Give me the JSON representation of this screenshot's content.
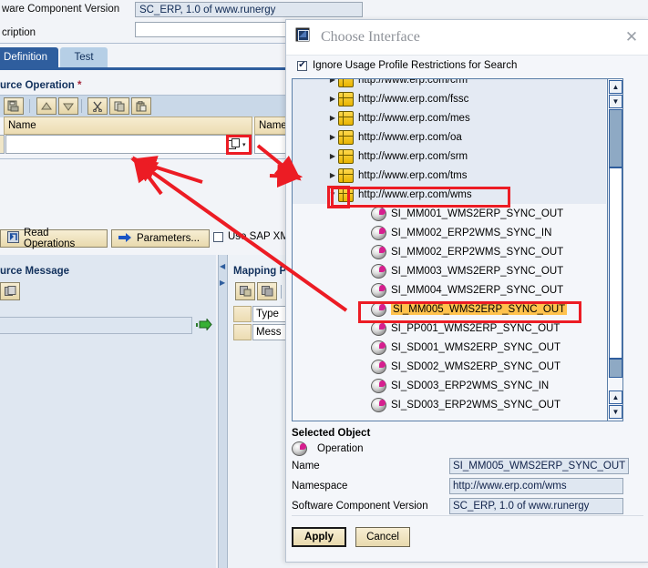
{
  "background": {
    "fields": [
      {
        "label": "ware Component Version",
        "value": "SC_ERP, 1.0 of www.runergy"
      },
      {
        "label": "cription",
        "value": ""
      }
    ],
    "tabs": [
      {
        "label": "Definition",
        "selected": true
      },
      {
        "label": "Test",
        "selected": false
      }
    ],
    "source_operation_title": "urce Operation",
    "required_marker": "*",
    "grid_header_left": "Name",
    "grid_header_right": "Name",
    "buttons": [
      {
        "label": "Read Operations",
        "icon": "read-operations-icon"
      },
      {
        "label": "Parameters...",
        "icon": "arrow-right-icon"
      }
    ],
    "checkbox_label": "Use SAP XM",
    "source_message_title": "urce Message",
    "mapping_panel_title": "Mapping P",
    "mapping_rows": [
      "Type",
      "Mess"
    ]
  },
  "dialog": {
    "title": "Choose Interface",
    "title_icon": "window-icon",
    "close_icon": "close-icon",
    "ignore_checkbox": {
      "label": "Ignore Usage Profile Restrictions for Search",
      "checked": true,
      "mark": "✔"
    },
    "tree": [
      {
        "label": "http://www.erp.com/crm",
        "type": "namespace",
        "expanded": false,
        "twisty": "▶",
        "indent": 0,
        "clipped": true,
        "selected": false
      },
      {
        "label": "http://www.erp.com/fssc",
        "type": "namespace",
        "expanded": false,
        "twisty": "▶",
        "indent": 0,
        "clipped": false,
        "selected": false
      },
      {
        "label": "http://www.erp.com/mes",
        "type": "namespace",
        "expanded": false,
        "twisty": "▶",
        "indent": 0,
        "clipped": false,
        "selected": false
      },
      {
        "label": "http://www.erp.com/oa",
        "type": "namespace",
        "expanded": false,
        "twisty": "▶",
        "indent": 0,
        "clipped": false,
        "selected": false
      },
      {
        "label": "http://www.erp.com/srm",
        "type": "namespace",
        "expanded": false,
        "twisty": "▶",
        "indent": 0,
        "clipped": false,
        "selected": false
      },
      {
        "label": "http://www.erp.com/tms",
        "type": "namespace",
        "expanded": false,
        "twisty": "▶",
        "indent": 0,
        "clipped": false,
        "selected": false
      },
      {
        "label": "http://www.erp.com/wms",
        "type": "namespace",
        "expanded": true,
        "twisty": "▼",
        "indent": 0,
        "clipped": false,
        "selected": false
      },
      {
        "label": "SI_MM001_WMS2ERP_SYNC_OUT",
        "type": "operation",
        "twisty": "",
        "indent": 1,
        "clipped": false,
        "selected": false
      },
      {
        "label": "SI_MM002_ERP2WMS_SYNC_IN",
        "type": "operation",
        "twisty": "",
        "indent": 1,
        "clipped": false,
        "selected": false
      },
      {
        "label": "SI_MM002_ERP2WMS_SYNC_OUT",
        "type": "operation",
        "twisty": "",
        "indent": 1,
        "clipped": false,
        "selected": false
      },
      {
        "label": "SI_MM003_WMS2ERP_SYNC_OUT",
        "type": "operation",
        "twisty": "",
        "indent": 1,
        "clipped": false,
        "selected": false
      },
      {
        "label": "SI_MM004_WMS2ERP_SYNC_OUT",
        "type": "operation",
        "twisty": "",
        "indent": 1,
        "clipped": false,
        "selected": false
      },
      {
        "label": "SI_MM005_WMS2ERP_SYNC_OUT",
        "type": "operation",
        "twisty": "",
        "indent": 1,
        "clipped": false,
        "selected": true
      },
      {
        "label": "SI_PP001_WMS2ERP_SYNC_OUT",
        "type": "operation",
        "twisty": "",
        "indent": 1,
        "clipped": false,
        "selected": false
      },
      {
        "label": "SI_SD001_WMS2ERP_SYNC_OUT",
        "type": "operation",
        "twisty": "",
        "indent": 1,
        "clipped": false,
        "selected": false
      },
      {
        "label": "SI_SD002_WMS2ERP_SYNC_OUT",
        "type": "operation",
        "twisty": "",
        "indent": 1,
        "clipped": false,
        "selected": false
      },
      {
        "label": "SI_SD003_ERP2WMS_SYNC_IN",
        "type": "operation",
        "twisty": "",
        "indent": 1,
        "clipped": false,
        "selected": false
      },
      {
        "label": "SI_SD003_ERP2WMS_SYNC_OUT",
        "type": "operation",
        "twisty": "",
        "indent": 1,
        "clipped": false,
        "selected": false
      }
    ],
    "scrollbar": {
      "up_icon": "▲",
      "down_icon": "▼"
    },
    "selected_object": {
      "heading": "Selected Object",
      "type_label": "Operation",
      "type_icon": "operation-icon",
      "rows": [
        {
          "label": "Name",
          "value": "SI_MM005_WMS2ERP_SYNC_OUT"
        },
        {
          "label": "Namespace",
          "value": "http://www.erp.com/wms"
        },
        {
          "label": "Software Component Version",
          "value": "SC_ERP, 1.0 of www.runergy"
        }
      ]
    },
    "footer": {
      "apply_label": "Apply",
      "cancel_label": "Cancel"
    }
  },
  "annotations": {
    "accent_color": "#ec1c24",
    "boxes": [
      {
        "name": "value-help-button-highlight"
      },
      {
        "name": "wms-namespace-row-highlight"
      },
      {
        "name": "selected-operation-highlight"
      },
      {
        "name": "expand-twisty-highlight"
      }
    ]
  }
}
